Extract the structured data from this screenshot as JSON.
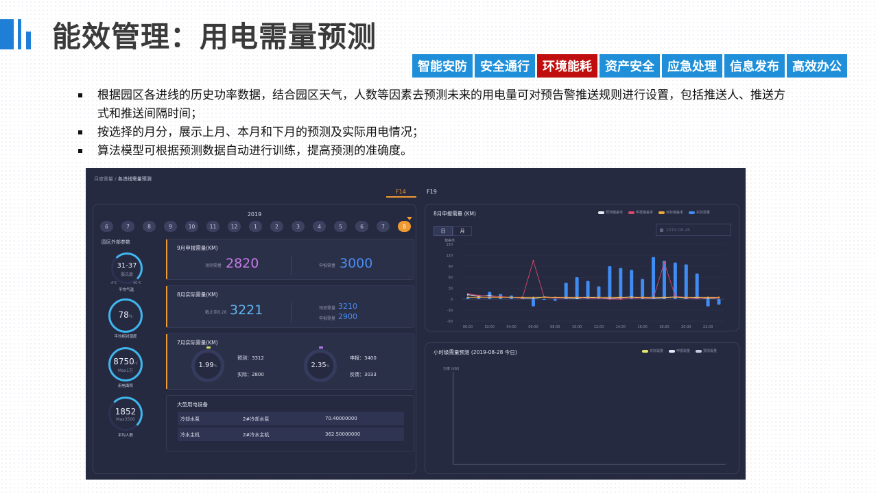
{
  "slide": {
    "title": "能效管理：用电需量预测",
    "accent": "#1f7fd6",
    "tabs": [
      {
        "label": "智能安防",
        "active": false
      },
      {
        "label": "安全通行",
        "active": false
      },
      {
        "label": "环境能耗",
        "active": true
      },
      {
        "label": "资产安全",
        "active": false
      },
      {
        "label": "应急处理",
        "active": false
      },
      {
        "label": "信息发布",
        "active": false
      },
      {
        "label": "高效办公",
        "active": false
      }
    ],
    "bullets": [
      "根据园区各进线的历史功率数据，结合园区天气，人数等因素去预测未来的用电量可对预告警推送规则进行设置，包括推送人、推送方式和推送间隔时间；",
      "按选择的月分，展示上月、本月和下月的预测及实际用电情况；",
      "算法模型可根据预测数据自动进行训练，提高预测的准确度。"
    ]
  },
  "app": {
    "breadcrumb": {
      "parent": "月度需量",
      "sep": " / ",
      "current": "各进线需量预测"
    },
    "feeder_tabs": [
      {
        "label": "F14",
        "active": true
      },
      {
        "label": "F19",
        "active": false
      }
    ],
    "year": "2019",
    "months": [
      "6",
      "7",
      "8",
      "9",
      "10",
      "11",
      "12",
      "1",
      "2",
      "3",
      "4",
      "5",
      "6",
      "7",
      "8"
    ],
    "selected_month_index": 14,
    "ext_params": {
      "title": "园区外部参数",
      "rings": [
        {
          "value": "31-37",
          "sub": "摄氏度",
          "min": "-4°C",
          "max": "40°C",
          "label": "平均气温",
          "level": 0.85
        },
        {
          "value": "78",
          "unit": "%",
          "label": "平均相对湿度",
          "level": 0.78
        },
        {
          "value": "8750",
          "unit": "㎡",
          "sub": "Max1万",
          "label": "用电面积",
          "level": 0.87
        },
        {
          "value": "1852",
          "sub": "Max3500",
          "label": "平均人数",
          "level": 0.53
        }
      ]
    },
    "sep_card": {
      "title": "9月申报需量(KM)",
      "pred_label": "预测需量",
      "pred": "2820",
      "decl_label": "申报需量",
      "decl": "3000"
    },
    "aug_card": {
      "title": "8月实际需量(KM)",
      "cut_label": "截止至8.28",
      "actual": "3221",
      "pred_label": "预测需量",
      "pred": "3210",
      "decl_label": "申报需量",
      "decl": "2900"
    },
    "jul_card": {
      "title": "7月实际需量(KM)",
      "left": {
        "value": "1.99",
        "unit": "%",
        "k1": "预测：3312",
        "k2": "实际：2800",
        "color": "#d6e55a"
      },
      "right": {
        "value": "2.35",
        "unit": "%",
        "k1": "申报：3400",
        "k2": "反馈：3033",
        "color": "#b778e8"
      }
    },
    "equipment": {
      "title": "大型用电设备",
      "rows": [
        {
          "name": "冷却水泵",
          "id": "2#冷却水泵",
          "value": "70.40000000"
        },
        {
          "name": "冷水主机",
          "id": "2#冷水主机",
          "value": "362.50000000"
        }
      ]
    },
    "aug_chart": {
      "title": "8月申报需量 (KM)",
      "toggle": [
        {
          "label": "日",
          "active": true
        },
        {
          "label": "月",
          "active": false
        }
      ],
      "date_value": "2019-08-26",
      "legend": [
        "预测偏差率",
        "申报偏差率",
        "目标偏差率",
        "实际需量"
      ],
      "colors": {
        "pred": "#e8ecf8",
        "decl": "#d9486e",
        "target": "#e8a93c",
        "actual": "#3f8cf2"
      }
    },
    "hourly": {
      "title": "小时级需量预测 (2019-08-28 今日)",
      "legend": [
        "实际需量",
        "申报需量",
        "预测需量"
      ],
      "ylabel": "功率 (kW)"
    }
  },
  "chart_data": {
    "type": "bar",
    "title": "8月申报需量 (KM)",
    "ylabel": "偏差率",
    "ylim": [
      -60,
      150
    ],
    "yticks": [
      150,
      120,
      90,
      60,
      30,
      0,
      -30,
      -60
    ],
    "xtick_labels": [
      "00:00",
      "02:00",
      "04:00",
      "06:00",
      "08:00",
      "10:00",
      "12:00",
      "14:00",
      "16:00",
      "18:00",
      "20:00",
      "22:00"
    ],
    "series": [
      {
        "name": "实际需量",
        "values": [
          5,
          10,
          20,
          14,
          10,
          5,
          -20,
          -2,
          -5,
          45,
          60,
          50,
          35,
          90,
          85,
          80,
          55,
          115,
          105,
          100,
          95,
          70,
          -20,
          -15
        ]
      },
      {
        "name": "预测偏差率",
        "values": [
          12,
          8,
          10,
          6,
          5,
          3,
          2,
          6,
          4,
          3,
          2,
          5,
          3,
          2,
          4,
          6,
          3,
          2,
          4,
          6,
          3,
          4,
          2,
          3
        ]
      },
      {
        "name": "申报偏差率",
        "values": [
          15,
          10,
          8,
          7,
          5,
          3,
          105,
          5,
          3,
          4,
          5,
          2,
          3,
          0,
          0,
          2,
          4,
          3,
          100,
          8,
          4,
          2,
          5,
          3
        ]
      },
      {
        "name": "目标偏差率",
        "values": [
          5,
          5,
          5,
          5,
          5,
          5,
          5,
          5,
          5,
          5,
          5,
          5,
          5,
          5,
          5,
          5,
          5,
          5,
          5,
          5,
          5,
          5,
          5,
          5
        ]
      }
    ]
  }
}
